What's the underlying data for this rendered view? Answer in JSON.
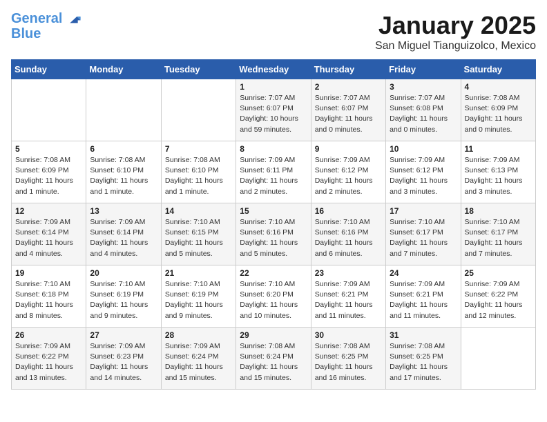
{
  "logo": {
    "line1": "General",
    "line2": "Blue"
  },
  "title": "January 2025",
  "location": "San Miguel Tianguizolco, Mexico",
  "days_header": [
    "Sunday",
    "Monday",
    "Tuesday",
    "Wednesday",
    "Thursday",
    "Friday",
    "Saturday"
  ],
  "weeks": [
    [
      {
        "day": "",
        "info": ""
      },
      {
        "day": "",
        "info": ""
      },
      {
        "day": "",
        "info": ""
      },
      {
        "day": "1",
        "info": "Sunrise: 7:07 AM\nSunset: 6:07 PM\nDaylight: 10 hours\nand 59 minutes."
      },
      {
        "day": "2",
        "info": "Sunrise: 7:07 AM\nSunset: 6:07 PM\nDaylight: 11 hours\nand 0 minutes."
      },
      {
        "day": "3",
        "info": "Sunrise: 7:07 AM\nSunset: 6:08 PM\nDaylight: 11 hours\nand 0 minutes."
      },
      {
        "day": "4",
        "info": "Sunrise: 7:08 AM\nSunset: 6:09 PM\nDaylight: 11 hours\nand 0 minutes."
      }
    ],
    [
      {
        "day": "5",
        "info": "Sunrise: 7:08 AM\nSunset: 6:09 PM\nDaylight: 11 hours\nand 1 minute."
      },
      {
        "day": "6",
        "info": "Sunrise: 7:08 AM\nSunset: 6:10 PM\nDaylight: 11 hours\nand 1 minute."
      },
      {
        "day": "7",
        "info": "Sunrise: 7:08 AM\nSunset: 6:10 PM\nDaylight: 11 hours\nand 1 minute."
      },
      {
        "day": "8",
        "info": "Sunrise: 7:09 AM\nSunset: 6:11 PM\nDaylight: 11 hours\nand 2 minutes."
      },
      {
        "day": "9",
        "info": "Sunrise: 7:09 AM\nSunset: 6:12 PM\nDaylight: 11 hours\nand 2 minutes."
      },
      {
        "day": "10",
        "info": "Sunrise: 7:09 AM\nSunset: 6:12 PM\nDaylight: 11 hours\nand 3 minutes."
      },
      {
        "day": "11",
        "info": "Sunrise: 7:09 AM\nSunset: 6:13 PM\nDaylight: 11 hours\nand 3 minutes."
      }
    ],
    [
      {
        "day": "12",
        "info": "Sunrise: 7:09 AM\nSunset: 6:14 PM\nDaylight: 11 hours\nand 4 minutes."
      },
      {
        "day": "13",
        "info": "Sunrise: 7:09 AM\nSunset: 6:14 PM\nDaylight: 11 hours\nand 4 minutes."
      },
      {
        "day": "14",
        "info": "Sunrise: 7:10 AM\nSunset: 6:15 PM\nDaylight: 11 hours\nand 5 minutes."
      },
      {
        "day": "15",
        "info": "Sunrise: 7:10 AM\nSunset: 6:16 PM\nDaylight: 11 hours\nand 5 minutes."
      },
      {
        "day": "16",
        "info": "Sunrise: 7:10 AM\nSunset: 6:16 PM\nDaylight: 11 hours\nand 6 minutes."
      },
      {
        "day": "17",
        "info": "Sunrise: 7:10 AM\nSunset: 6:17 PM\nDaylight: 11 hours\nand 7 minutes."
      },
      {
        "day": "18",
        "info": "Sunrise: 7:10 AM\nSunset: 6:17 PM\nDaylight: 11 hours\nand 7 minutes."
      }
    ],
    [
      {
        "day": "19",
        "info": "Sunrise: 7:10 AM\nSunset: 6:18 PM\nDaylight: 11 hours\nand 8 minutes."
      },
      {
        "day": "20",
        "info": "Sunrise: 7:10 AM\nSunset: 6:19 PM\nDaylight: 11 hours\nand 9 minutes."
      },
      {
        "day": "21",
        "info": "Sunrise: 7:10 AM\nSunset: 6:19 PM\nDaylight: 11 hours\nand 9 minutes."
      },
      {
        "day": "22",
        "info": "Sunrise: 7:10 AM\nSunset: 6:20 PM\nDaylight: 11 hours\nand 10 minutes."
      },
      {
        "day": "23",
        "info": "Sunrise: 7:09 AM\nSunset: 6:21 PM\nDaylight: 11 hours\nand 11 minutes."
      },
      {
        "day": "24",
        "info": "Sunrise: 7:09 AM\nSunset: 6:21 PM\nDaylight: 11 hours\nand 11 minutes."
      },
      {
        "day": "25",
        "info": "Sunrise: 7:09 AM\nSunset: 6:22 PM\nDaylight: 11 hours\nand 12 minutes."
      }
    ],
    [
      {
        "day": "26",
        "info": "Sunrise: 7:09 AM\nSunset: 6:22 PM\nDaylight: 11 hours\nand 13 minutes."
      },
      {
        "day": "27",
        "info": "Sunrise: 7:09 AM\nSunset: 6:23 PM\nDaylight: 11 hours\nand 14 minutes."
      },
      {
        "day": "28",
        "info": "Sunrise: 7:09 AM\nSunset: 6:24 PM\nDaylight: 11 hours\nand 15 minutes."
      },
      {
        "day": "29",
        "info": "Sunrise: 7:08 AM\nSunset: 6:24 PM\nDaylight: 11 hours\nand 15 minutes."
      },
      {
        "day": "30",
        "info": "Sunrise: 7:08 AM\nSunset: 6:25 PM\nDaylight: 11 hours\nand 16 minutes."
      },
      {
        "day": "31",
        "info": "Sunrise: 7:08 AM\nSunset: 6:25 PM\nDaylight: 11 hours\nand 17 minutes."
      },
      {
        "day": "",
        "info": ""
      }
    ]
  ]
}
